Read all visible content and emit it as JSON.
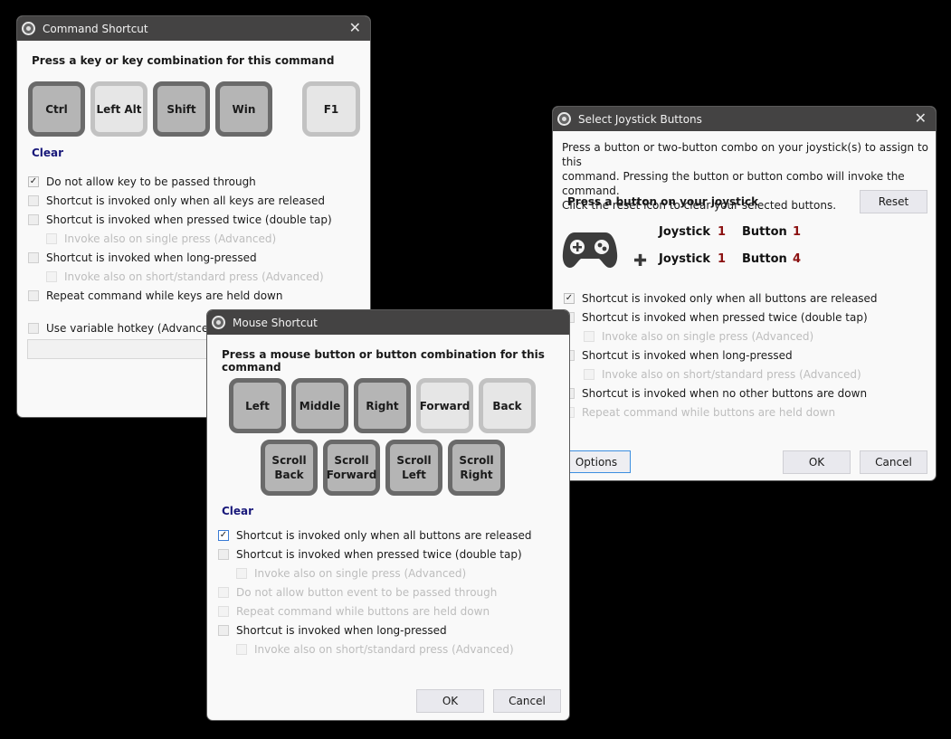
{
  "command_shortcut": {
    "title": "Command Shortcut",
    "heading": "Press a key or key combination for this command",
    "keys": [
      {
        "label": "Ctrl",
        "active": true
      },
      {
        "label": "Left Alt",
        "active": false
      },
      {
        "label": "Shift",
        "active": true
      },
      {
        "label": "Win",
        "active": true
      },
      {
        "label": "F1",
        "active": false
      }
    ],
    "clear_label": "Clear",
    "options": [
      {
        "label": "Do not allow key to be passed through",
        "checked": true,
        "disabled": false
      },
      {
        "label": "Shortcut is invoked only when all keys are released",
        "checked": false,
        "disabled": false
      },
      {
        "label": "Shortcut is invoked when pressed twice (double tap)",
        "checked": false,
        "disabled": false
      },
      {
        "label": "Invoke also on single press (Advanced)",
        "checked": false,
        "disabled": true
      },
      {
        "label": "Shortcut is invoked when long-pressed",
        "checked": false,
        "disabled": false
      },
      {
        "label": "Invoke also on short/standard press (Advanced)",
        "checked": false,
        "disabled": true
      },
      {
        "label": "Repeat command while keys are held down",
        "checked": false,
        "disabled": false
      },
      {
        "label": "Use variable hotkey (Advanced)",
        "checked": false,
        "disabled": false
      }
    ],
    "variable_hotkey_value": ""
  },
  "mouse_shortcut": {
    "title": "Mouse Shortcut",
    "heading": "Press a mouse button or button combination for this command",
    "buttons_row1": [
      {
        "label": "Left",
        "active": true
      },
      {
        "label": "Middle",
        "active": true
      },
      {
        "label": "Right",
        "active": true
      },
      {
        "label": "Forward",
        "active": false
      },
      {
        "label": "Back",
        "active": false
      }
    ],
    "buttons_row2": [
      {
        "line1": "Scroll",
        "line2": "Back",
        "active": true
      },
      {
        "line1": "Scroll",
        "line2": "Forward",
        "active": true
      },
      {
        "line1": "Scroll",
        "line2": "Left",
        "active": true
      },
      {
        "line1": "Scroll",
        "line2": "Right",
        "active": true
      }
    ],
    "clear_label": "Clear",
    "options": [
      {
        "label": "Shortcut is invoked only when all buttons are released",
        "checked": true,
        "disabled": false
      },
      {
        "label": "Shortcut is invoked when pressed twice (double tap)",
        "checked": false,
        "disabled": false
      },
      {
        "label": "Invoke also on single press (Advanced)",
        "checked": false,
        "disabled": true
      },
      {
        "label": "Do not allow button event to be passed through",
        "checked": false,
        "disabled": true
      },
      {
        "label": "Repeat command while buttons are held down",
        "checked": false,
        "disabled": true
      },
      {
        "label": "Shortcut is invoked when long-pressed",
        "checked": false,
        "disabled": false
      },
      {
        "label": "Invoke also on short/standard press (Advanced)",
        "checked": false,
        "disabled": true
      }
    ],
    "ok_label": "OK",
    "cancel_label": "Cancel"
  },
  "joystick": {
    "title": "Select Joystick Buttons",
    "description_lines": [
      "Press a button or two-button combo on your joystick(s) to assign to this",
      "command.  Pressing the button or button combo will invoke the command.",
      "Click the reset icon to clear your selected buttons."
    ],
    "prompt": "Press a button on your joystick",
    "reset_label": "Reset",
    "combo": [
      {
        "joystick_label": "Joystick",
        "joystick": "1",
        "button_label": "Button",
        "button": "1"
      },
      {
        "joystick_label": "Joystick",
        "joystick": "1",
        "button_label": "Button",
        "button": "4"
      }
    ],
    "options": [
      {
        "label": "Shortcut is invoked only when all buttons are released",
        "checked": true,
        "disabled": false
      },
      {
        "label": "Shortcut is invoked when pressed twice (double tap)",
        "checked": false,
        "disabled": false
      },
      {
        "label": "Invoke also on single press (Advanced)",
        "checked": false,
        "disabled": true
      },
      {
        "label": "Shortcut is invoked when long-pressed",
        "checked": false,
        "disabled": false
      },
      {
        "label": "Invoke also on short/standard press (Advanced)",
        "checked": false,
        "disabled": true
      },
      {
        "label": "Shortcut is invoked when no other buttons are down",
        "checked": false,
        "disabled": false
      },
      {
        "label": "Repeat command while buttons are held down",
        "checked": false,
        "disabled": true
      }
    ],
    "options_label": "Options",
    "ok_label": "OK",
    "cancel_label": "Cancel"
  },
  "icons": {
    "check": "✓",
    "close": "✕",
    "plus": "✚"
  }
}
